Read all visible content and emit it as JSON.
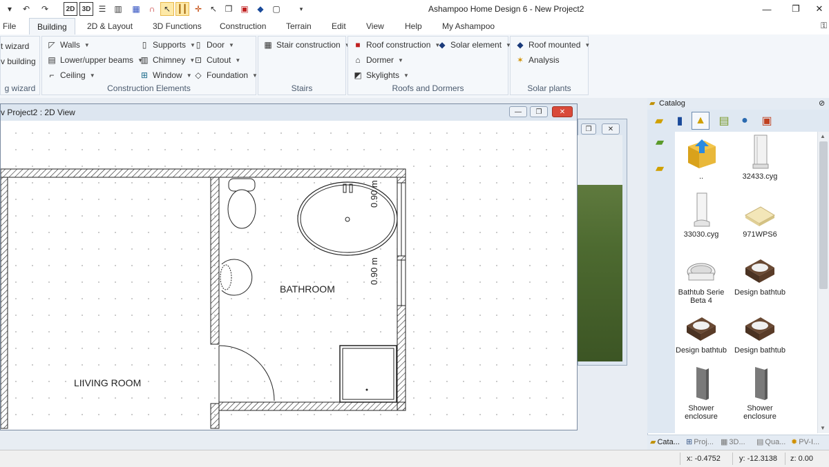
{
  "app_title": "Ashampoo Home Design 6 - New Project2",
  "quick_toolbar": {
    "icons": [
      "undo-icon",
      "redo-icon",
      "view-2d-icon",
      "view-3d-icon",
      "horizontal-split-icon",
      "vertical-split-icon",
      "grid-icon",
      "magnet-icon",
      "pointer-icon",
      "vertical-lines-icon",
      "crosshair-icon",
      "select-arrow-icon",
      "copy-icon",
      "image-icon",
      "eraser-icon",
      "paste-icon"
    ],
    "label_2d": "2D",
    "label_3d": "3D"
  },
  "window_controls": {
    "minimize": "—",
    "maximize": "❐",
    "close": "✕"
  },
  "menu_tabs": [
    "File",
    "Building",
    "2D & Layout",
    "3D Functions",
    "Construction",
    "Terrain",
    "Edit",
    "View",
    "Help",
    "My Ashampoo"
  ],
  "active_tab": "Building",
  "ribbon": {
    "wizard_group": {
      "items": [
        "t wizard",
        "v building"
      ],
      "label": "g wizard"
    },
    "construction_elements": {
      "label": "Construction Elements",
      "walls": "Walls",
      "lower_upper_beams": "Lower/upper beams",
      "ceiling": "Ceiling",
      "supports": "Supports",
      "chimney": "Chimney",
      "window": "Window",
      "door": "Door",
      "cutout": "Cutout",
      "foundation": "Foundation"
    },
    "stairs": {
      "label": "Stairs",
      "stair_construction": "Stair construction"
    },
    "roofs_dormers": {
      "label": "Roofs and Dormers",
      "roof_construction": "Roof construction",
      "dormer": "Dormer",
      "skylights": "Skylights",
      "solar_element": "Solar element"
    },
    "solar_plants": {
      "label": "Solar plants",
      "roof_mounted": "Roof mounted",
      "analysis": "Analysis"
    }
  },
  "view2d": {
    "title": "v Project2 : 2D View",
    "rooms": {
      "living": "LIIVING ROOM",
      "bath": "BATHROOM"
    },
    "dims": {
      "upper": "0.90 m",
      "lower": "0.90 m"
    }
  },
  "catalog": {
    "title": "Catalog",
    "items": [
      {
        "label": "..",
        "icon": "folder-up-icon"
      },
      {
        "label": "32433.cyg",
        "icon": "shower-cabin-icon"
      },
      {
        "label": "33030.cyg",
        "icon": "shower-cabin-icon"
      },
      {
        "label": "971WPS6",
        "icon": "shower-tray-icon"
      },
      {
        "label": "Bathtub Serie Beta 4",
        "icon": "bathtub-icon"
      },
      {
        "label": "Design bathtub",
        "icon": "bathtub-icon"
      },
      {
        "label": "Design bathtub",
        "icon": "bathtub-icon"
      },
      {
        "label": "Design bathtub",
        "icon": "bathtub-icon"
      },
      {
        "label": "Shower enclosure",
        "icon": "shower-enclosure-icon"
      },
      {
        "label": "Shower enclosure",
        "icon": "shower-enclosure-icon"
      }
    ],
    "tabs": [
      "Cata...",
      "Proj...",
      "3D...",
      "Qua...",
      "PV-I..."
    ]
  },
  "status": {
    "x": "x: -0.4752",
    "y": "y: -12.3138",
    "z": "z: 0.00"
  }
}
